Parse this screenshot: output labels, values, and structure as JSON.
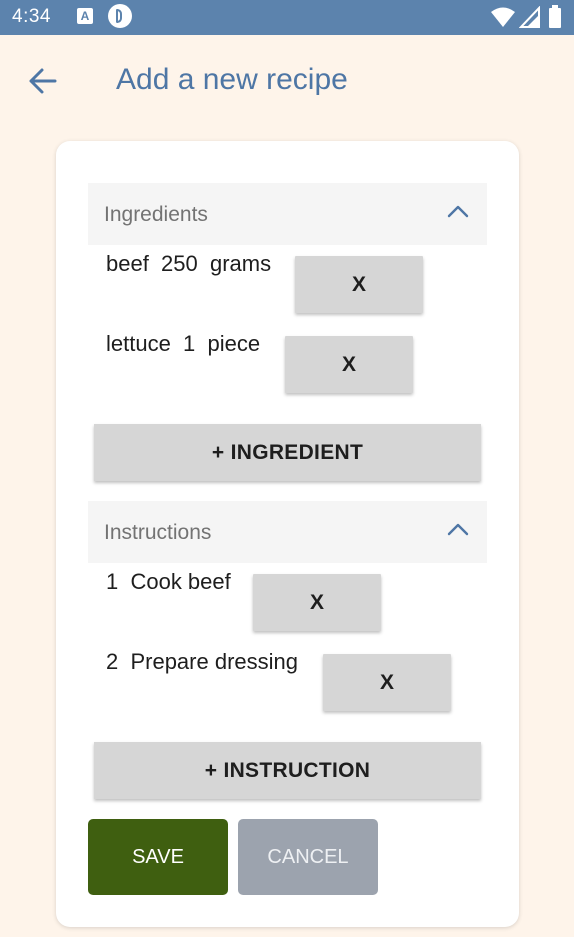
{
  "status_bar": {
    "time": "4:34",
    "a_icon_letter": "A"
  },
  "app_bar": {
    "title": "Add a new recipe"
  },
  "ingredients": {
    "header": "Ingredients",
    "items": [
      {
        "text": "beef  250  grams",
        "remove_label": "X"
      },
      {
        "text": "lettuce  1  piece",
        "remove_label": "X"
      }
    ],
    "add_label": "+ INGREDIENT"
  },
  "instructions": {
    "header": "Instructions",
    "items": [
      {
        "text": "1  Cook beef",
        "remove_label": "X"
      },
      {
        "text": "2  Prepare dressing",
        "remove_label": "X"
      }
    ],
    "add_label": "+ INSTRUCTION"
  },
  "actions": {
    "save_label": "SAVE",
    "cancel_label": "CANCEL"
  },
  "colors": {
    "status_bar": "#5c83ad",
    "accent": "#4e76a5",
    "save": "#3f5f10",
    "cancel": "#9ca3ae",
    "background": "#fef4ea"
  },
  "icons": {
    "back": "arrow-left-icon",
    "chevron": "chevron-up-icon",
    "wifi": "wifi-icon",
    "signal": "signal-icon",
    "battery": "battery-icon"
  }
}
